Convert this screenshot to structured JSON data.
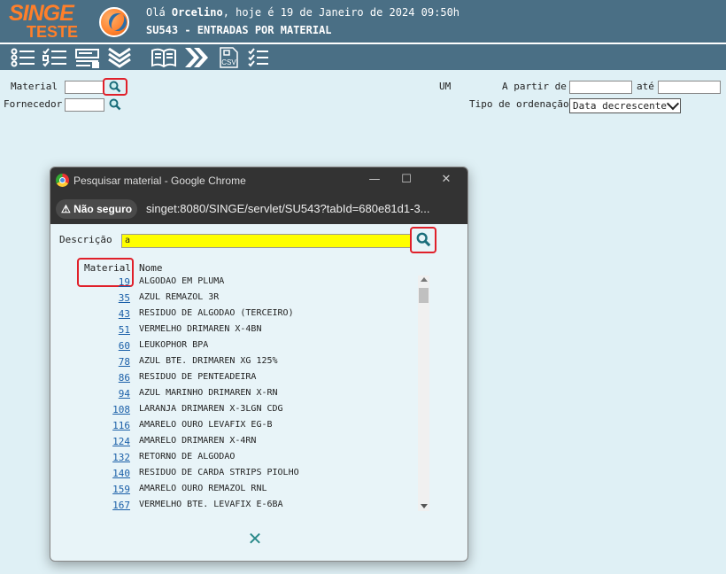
{
  "header": {
    "logo_line1": "SINGE",
    "logo_line2": "TESTE",
    "greeting_prefix": "Olá ",
    "user": "Orcelino",
    "greeting_suffix": ", hoje é 19 de Janeiro de 2024 09:50h",
    "page_title": "SU543 - ENTRADAS POR MATERIAL"
  },
  "toolbar": {
    "icons": [
      "list-icon",
      "checklist-icon",
      "form-icon",
      "collapse-chevrons-icon",
      "book-icon",
      "forward-icon",
      "csv-icon",
      "checklist-alt-icon"
    ],
    "csv_label": "CSV"
  },
  "form": {
    "material_label": "Material",
    "material_value": "",
    "fornecedor_label": "Fornecedor",
    "fornecedor_value": "",
    "um_label": "UM",
    "a_partir_label": "A partir de",
    "a_partir_value": "",
    "ate_label": "até",
    "ate_value": "",
    "ordenacao_label": "Tipo de ordenação",
    "ordenacao_selected": "Data decrescente"
  },
  "popup": {
    "window_title": "Pesquisar material - Google Chrome",
    "security_label": "Não seguro",
    "url": "singet:8080/SINGE/servlet/SU543?tabId=680e81d1-3...",
    "descricao_label": "Descrição",
    "descricao_value": "a",
    "col_material": "Material",
    "col_nome": "Nome",
    "rows": [
      {
        "code": "19",
        "name": "ALGODAO EM PLUMA"
      },
      {
        "code": "35",
        "name": "AZUL REMAZOL 3R"
      },
      {
        "code": "43",
        "name": "RESIDUO DE ALGODAO (TERCEIRO)"
      },
      {
        "code": "51",
        "name": "VERMELHO DRIMAREN X-4BN"
      },
      {
        "code": "60",
        "name": "LEUKOPHOR BPA"
      },
      {
        "code": "78",
        "name": "AZUL BTE. DRIMAREN XG 125%"
      },
      {
        "code": "86",
        "name": "RESIDUO DE PENTEADEIRA"
      },
      {
        "code": "94",
        "name": "AZUL MARINHO DRIMAREN X-RN"
      },
      {
        "code": "108",
        "name": "LARANJA DRIMAREN X-3LGN CDG"
      },
      {
        "code": "116",
        "name": "AMARELO OURO LEVAFIX EG-B"
      },
      {
        "code": "124",
        "name": "AMARELO DRIMAREN X-4RN"
      },
      {
        "code": "132",
        "name": "RETORNO DE ALGODAO"
      },
      {
        "code": "140",
        "name": "RESIDUO DE CARDA STRIPS PIOLHO"
      },
      {
        "code": "159",
        "name": "AMARELO OURO REMAZOL RNL"
      },
      {
        "code": "167",
        "name": "VERMELHO BTE. LEVAFIX E-6BA"
      }
    ],
    "close_symbol": "✕"
  },
  "colors": {
    "header_bg": "#4a6f85",
    "logo_orange": "#ff7f2a",
    "page_bg": "#dff0f5",
    "highlight": "#e0202a",
    "search_field": "#ffff00",
    "link": "#1a5fa8"
  }
}
